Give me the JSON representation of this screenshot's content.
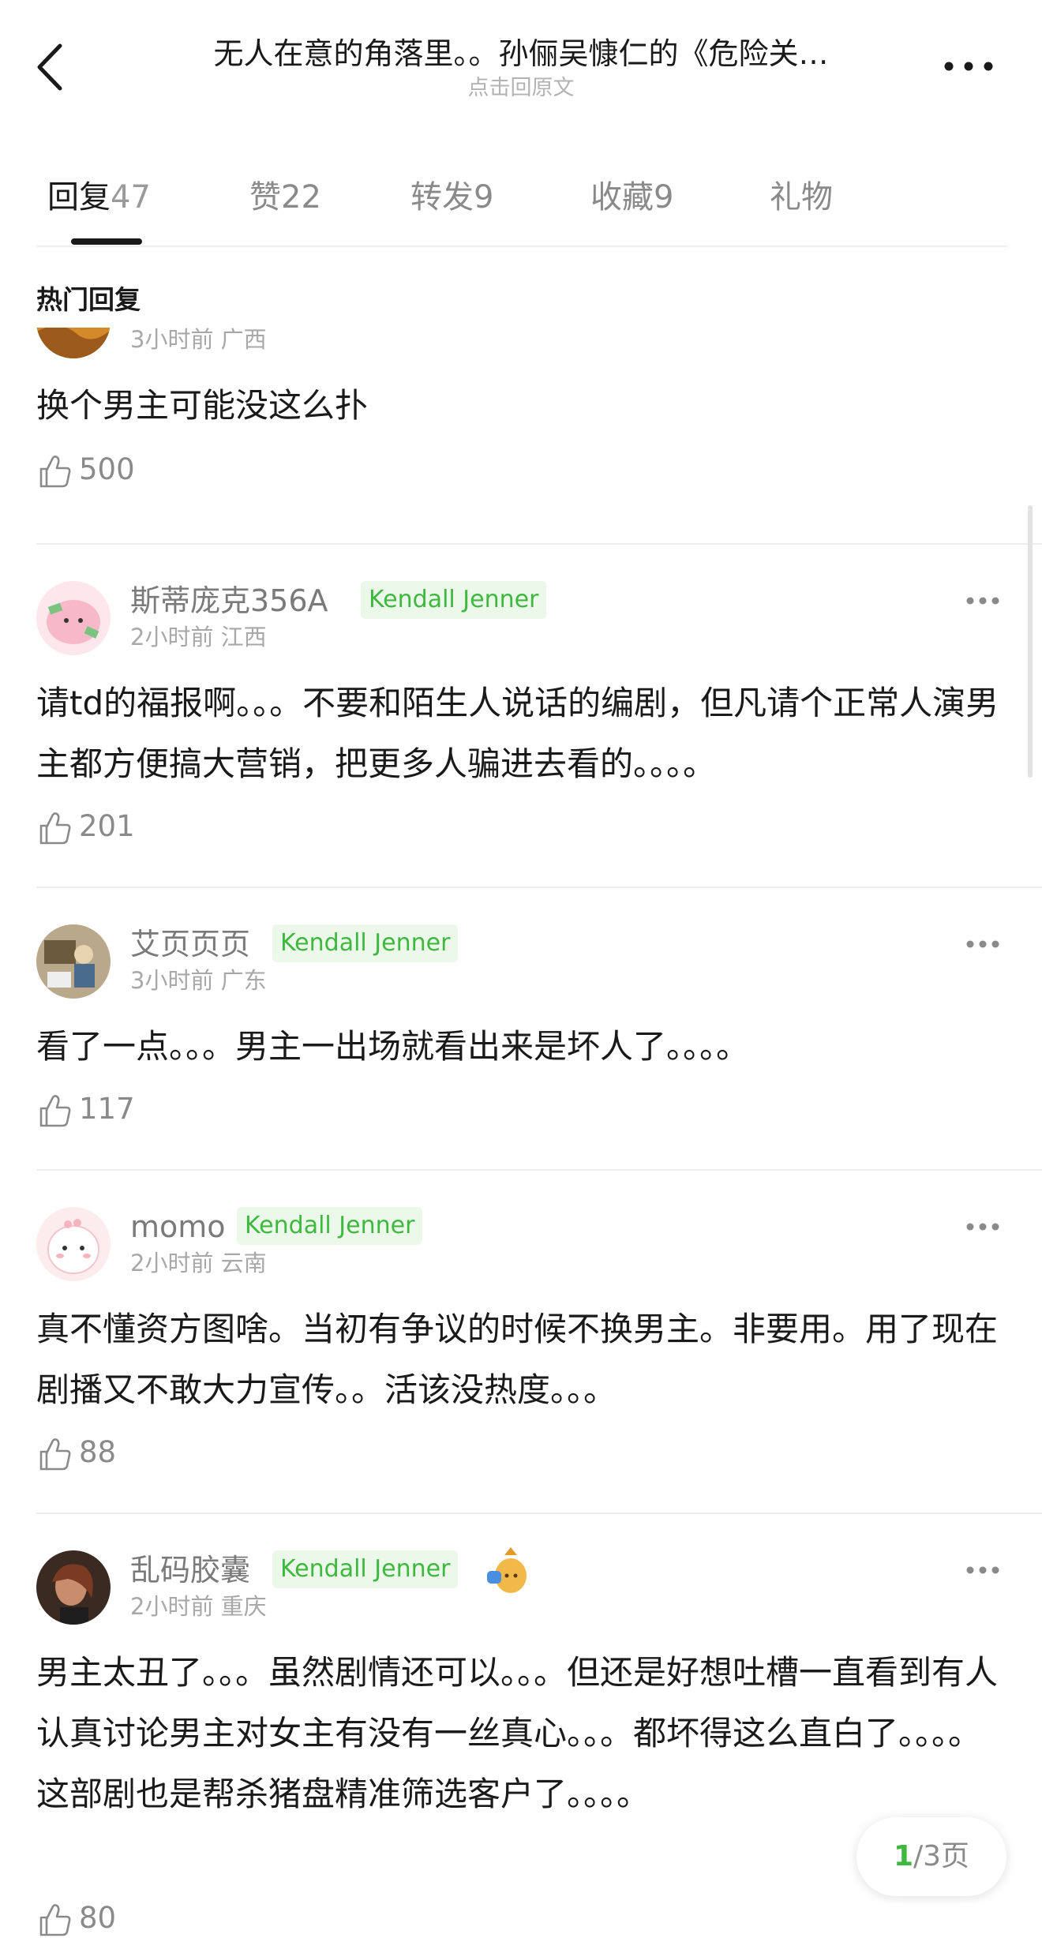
{
  "header": {
    "title": "无人在意的角落里。。孙俪吴慷仁的《危险关…",
    "subtitle": "点击回原文"
  },
  "tabs": [
    {
      "label": "回复",
      "count": "47",
      "active": true
    },
    {
      "label": "赞",
      "count": "22"
    },
    {
      "label": "转发",
      "count": "9"
    },
    {
      "label": "收藏",
      "count": "9"
    },
    {
      "label": "礼物",
      "count": ""
    }
  ],
  "section_title": "热门回复",
  "comments": [
    {
      "username": "",
      "time": "3小时前",
      "location": "广西",
      "content": "换个男主可能没这么扑",
      "likes": "500"
    },
    {
      "username": "斯蒂庞克356A",
      "badge": "Kendall Jenner",
      "time": "2小时前",
      "location": "江西",
      "content": "请td的福报啊。。。不要和陌生人说话的编剧，但凡请个正常人演男主都方便搞大营销，把更多人骗进去看的。。。。",
      "likes": "201"
    },
    {
      "username": "艾页页页",
      "badge": "Kendall Jenner",
      "time": "3小时前",
      "location": "广东",
      "content": "看了一点。。。男主一出场就看出来是坏人了。。。。",
      "likes": "117"
    },
    {
      "username": "momo",
      "badge": "Kendall Jenner",
      "time": "2小时前",
      "location": "云南",
      "content": "真不懂资方图啥。当初有争议的时候不换男主。非要用。用了现在剧播又不敢大力宣传。。活该没热度。。。",
      "likes": "88"
    },
    {
      "username": "乱码胶囊",
      "badge": "Kendall Jenner",
      "time": "2小时前",
      "location": "重庆",
      "content": "男主太丑了。。。虽然剧情还可以。。。但还是好想吐槽一直看到有人认真讨论男主对女主有没有一丝真心。。。都坏得这么直白了。。。。这部剧也是帮杀猪盘精准筛选客户了。。。。",
      "likes": "80"
    }
  ],
  "pager": {
    "current": "1",
    "total_text": "/3页"
  },
  "colors": {
    "accent_green": "#3fb83f",
    "badge_bg": "#ebf8ea",
    "text_primary": "#1a1a1a",
    "text_secondary": "#8a8a8a"
  },
  "icons": [
    "back-chevron-icon",
    "more-dots-icon",
    "thumbs-up-icon",
    "gift-bag-icon"
  ]
}
